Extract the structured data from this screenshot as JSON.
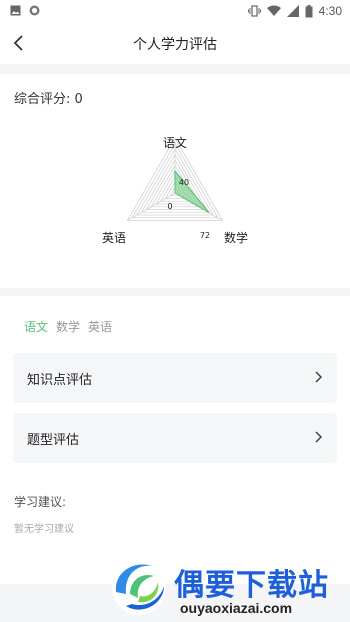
{
  "status_bar": {
    "time": "4:30",
    "icons": [
      "image-icon",
      "circle-icon",
      "vibrate-icon",
      "wifi-icon",
      "signal-icon",
      "battery-icon"
    ]
  },
  "header": {
    "title": "个人学力评估"
  },
  "score": {
    "label": "综合评分: 0"
  },
  "radar_chart": {
    "axes": [
      "语文",
      "数学",
      "英语"
    ],
    "values": [
      40,
      72,
      0
    ],
    "color": "#7fd08f"
  },
  "tabs": [
    {
      "label": "语文",
      "active": true
    },
    {
      "label": "数学",
      "active": false
    },
    {
      "label": "英语",
      "active": false
    }
  ],
  "cards": [
    {
      "label": "知识点评估"
    },
    {
      "label": "题型评估"
    }
  ],
  "advice": {
    "title": "学习建议:",
    "text": "暂无学习建议"
  },
  "watermark": {
    "title": "偶要下载站",
    "url": "ouyaoxiazai.com"
  },
  "colors": {
    "accent": "#57c27a",
    "card_bg": "#f5f6f8",
    "watermark_blue": "#1d5fd8"
  }
}
